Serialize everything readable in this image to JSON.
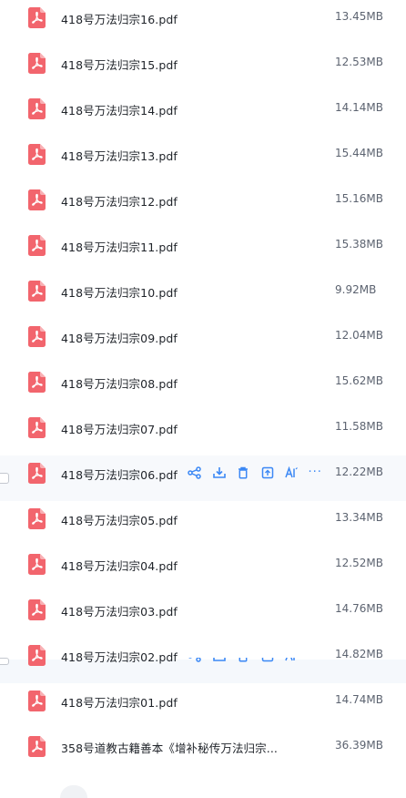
{
  "files": [
    {
      "name": "418号万法归宗16.pdf",
      "size": "13.45MB"
    },
    {
      "name": "418号万法归宗15.pdf",
      "size": "12.53MB"
    },
    {
      "name": "418号万法归宗14.pdf",
      "size": "14.14MB"
    },
    {
      "name": "418号万法归宗13.pdf",
      "size": "15.44MB"
    },
    {
      "name": "418号万法归宗12.pdf",
      "size": "15.16MB"
    },
    {
      "name": "418号万法归宗11.pdf",
      "size": "15.38MB"
    },
    {
      "name": "418号万法归宗10.pdf",
      "size": "9.92MB"
    },
    {
      "name": "418号万法归宗09.pdf",
      "size": "12.04MB"
    },
    {
      "name": "418号万法归宗08.pdf",
      "size": "15.62MB"
    },
    {
      "name": "418号万法归宗07.pdf",
      "size": "11.58MB"
    },
    {
      "name": "418号万法归宗06.pdf",
      "size": "12.22MB"
    },
    {
      "name": "418号万法归宗05.pdf",
      "size": "13.34MB"
    },
    {
      "name": "418号万法归宗04.pdf",
      "size": "12.52MB"
    },
    {
      "name": "418号万法归宗03.pdf",
      "size": "14.76MB"
    },
    {
      "name": "418号万法归宗02.pdf",
      "size": "14.82MB"
    },
    {
      "name": "418号万法归宗01.pdf",
      "size": "14.74MB"
    },
    {
      "name": "358号道教古籍善本《增补秘传万法归宗...",
      "size": "36.39MB"
    }
  ],
  "row_actions": {
    "more": "···"
  },
  "colors": {
    "pdf_icon": "#f2656d",
    "action_icon": "#3b88f5",
    "file_name": "#1f2329",
    "file_size": "#5c6370"
  }
}
